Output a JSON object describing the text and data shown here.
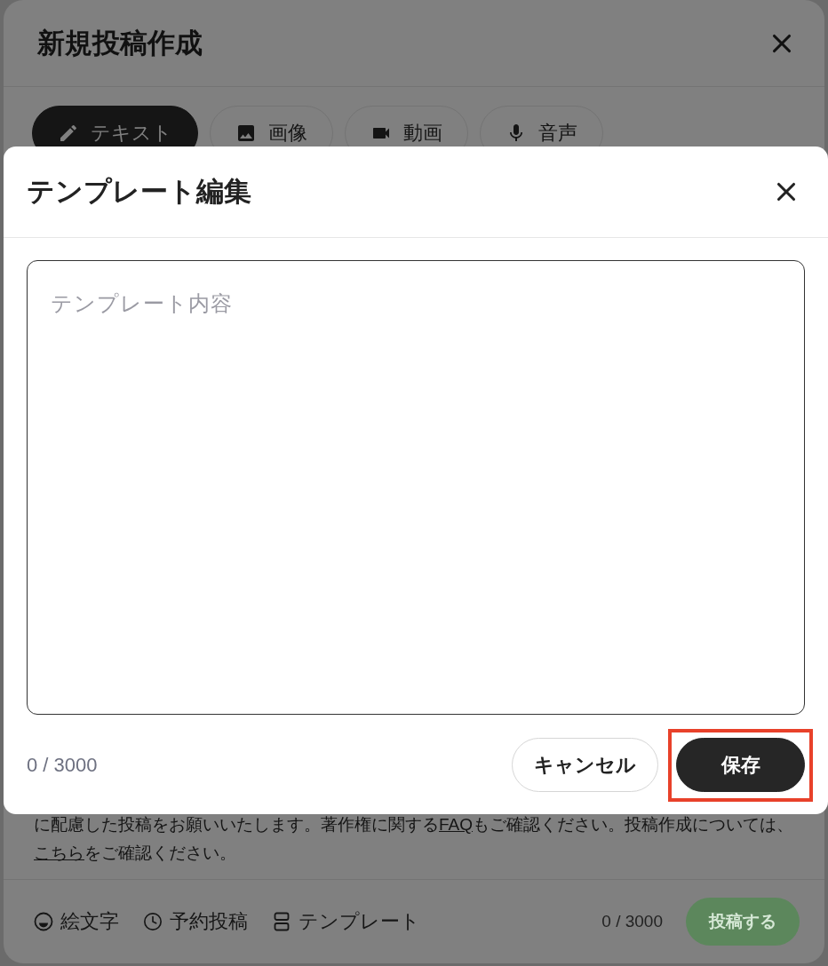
{
  "post_dialog": {
    "title": "新規投稿作成",
    "tabs": [
      {
        "kind": "text",
        "label": "テキスト",
        "selected": true
      },
      {
        "kind": "image",
        "label": "画像",
        "selected": false
      },
      {
        "kind": "video",
        "label": "動画",
        "selected": false
      },
      {
        "kind": "audio",
        "label": "音声",
        "selected": false
      }
    ],
    "notice_lines": [
      [
        {
          "kind": "plain",
          "text": "に配慮した投稿をお願いいたします。著作権に関する"
        },
        {
          "kind": "link",
          "text": "FAQ"
        },
        {
          "kind": "plain",
          "text": "もご確認ください。投稿作成については、"
        }
      ],
      [
        {
          "kind": "link",
          "text": "こちら"
        },
        {
          "kind": "plain",
          "text": "をご確認ください。"
        }
      ]
    ],
    "tools": [
      {
        "kind": "emoji",
        "label": "絵文字"
      },
      {
        "kind": "schedule",
        "label": "予約投稿"
      },
      {
        "kind": "template",
        "label": "テンプレート"
      }
    ],
    "counter": "0 / 3000",
    "submit": {
      "label": "投稿する",
      "disabled": true
    }
  },
  "template_dialog": {
    "title": "テンプレート編集",
    "content": {
      "placeholder": "テンプレート内容"
    },
    "counter": "0 / 3000",
    "buttons": [
      {
        "kind": "secondary",
        "label": "キャンセル",
        "highlighted": false
      },
      {
        "kind": "primary",
        "label": "保存",
        "highlighted": true
      }
    ]
  }
}
